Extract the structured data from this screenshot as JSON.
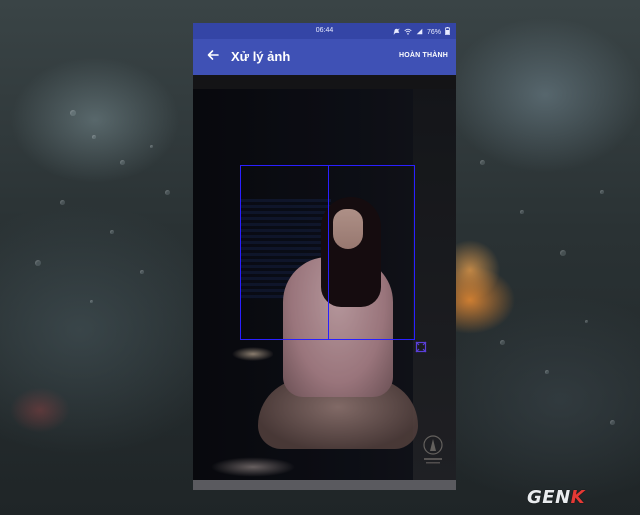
{
  "status_bar": {
    "time": "06:44",
    "battery": "76%",
    "icons": [
      "silent-icon",
      "wifi-icon",
      "signal-icon",
      "battery-icon"
    ]
  },
  "app_bar": {
    "back_icon": "arrow-left-icon",
    "title": "Xử lý ảnh",
    "done_label": "HOÀN THÀNH",
    "color": "#3f51b5",
    "status_color": "#3445a6"
  },
  "editor": {
    "crop_color": "#2a1fff",
    "handle_icon": "resize-corner-icon",
    "watermark_icon": "watermark-icon"
  },
  "brand": {
    "logo_text_main": "GEN",
    "logo_text_accent": "K"
  }
}
